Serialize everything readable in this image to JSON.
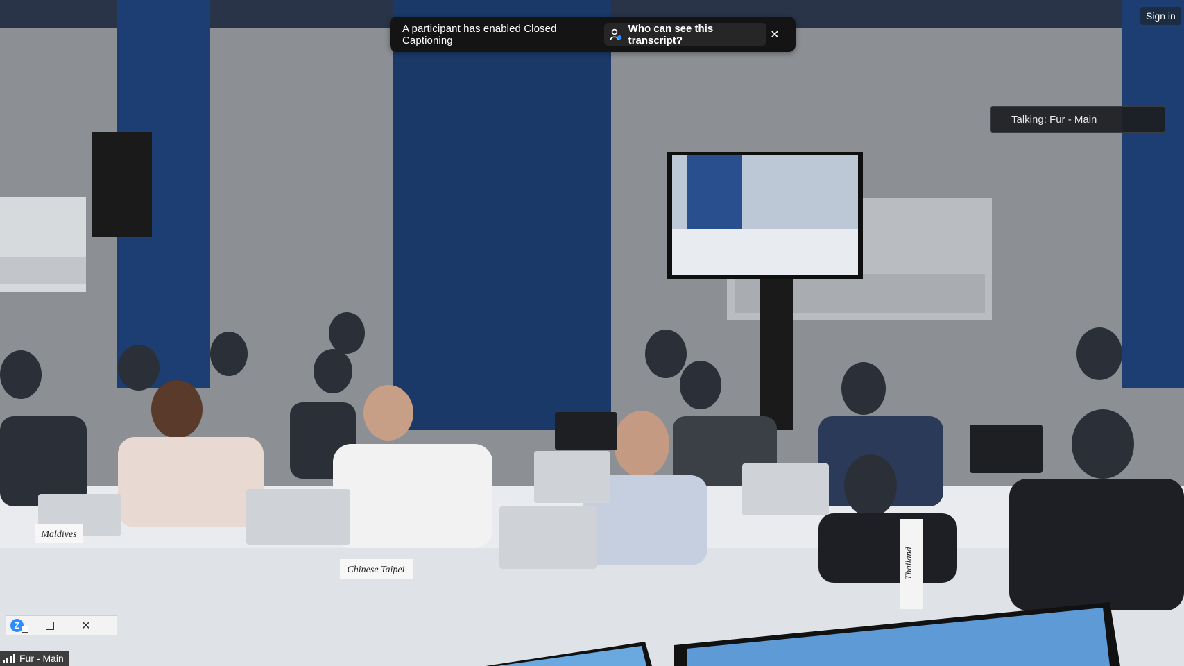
{
  "banner": {
    "message": "A participant has enabled Closed Captioning",
    "link_label": "Who can see this transcript?",
    "link_icon": "person-icon",
    "close_icon": "close-icon",
    "close_glyph": "✕"
  },
  "header": {
    "sign_in_label": "Sign in"
  },
  "active_speaker": {
    "label": "Talking: Fur - Main"
  },
  "mini_window": {
    "logo_icon": "zoom-logo-icon",
    "logo_letter": "Z",
    "maximize_icon": "maximize-icon",
    "close_icon": "close-icon",
    "close_glyph": "✕"
  },
  "participant": {
    "name": "Fur - Main",
    "signal_icon": "signal-strength-icon"
  },
  "scene": {
    "table_placards": [
      "Maldives",
      "Chinese Taipei",
      "Thailand"
    ]
  },
  "colors": {
    "wall": "#8c8f93",
    "pillar": "#1c3e72",
    "banner_bg": "#141414",
    "zoom_blue": "#2d8cff"
  }
}
